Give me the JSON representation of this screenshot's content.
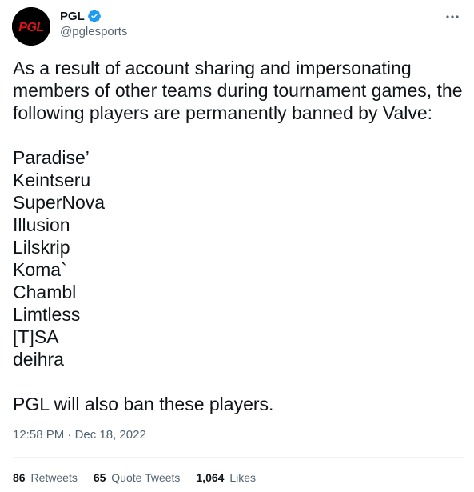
{
  "author": {
    "display_name": "PGL",
    "handle": "@pglesports",
    "avatar_text": "PGL",
    "verified": true,
    "accent_color": "#1d9bf0",
    "avatar_logo_color": "#e0131c"
  },
  "tweet": {
    "intro": "As a result of account sharing and impersonating members of other teams during tournament games, the following players are permanently banned by Valve:",
    "players": [
      "Paradise’",
      "Keintseru",
      "SuperNova",
      "Illusion",
      "Lilskrip",
      "Koma`",
      "Chambl",
      "Limtless",
      "[T]SA",
      "deihra"
    ],
    "closing": "PGL will also ban these players.",
    "time": "12:58 PM",
    "separator": "·",
    "date": "Dec 18, 2022"
  },
  "stats": {
    "retweets_count": "86",
    "retweets_label": "Retweets",
    "quotes_count": "65",
    "quotes_label": "Quote Tweets",
    "likes_count": "1,064",
    "likes_label": "Likes"
  },
  "icons": {
    "more": "more-horizontal-icon",
    "verified": "verified-badge-icon"
  }
}
